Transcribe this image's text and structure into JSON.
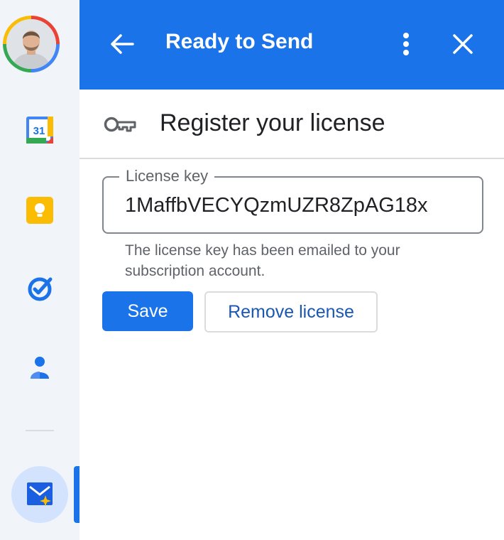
{
  "header": {
    "title": "Ready to Send",
    "back_icon": "arrow-left-icon",
    "menu_icon": "more-vert-icon",
    "close_icon": "close-icon",
    "color": "#1a73e8"
  },
  "section": {
    "title": "Register your license",
    "icon": "key-icon"
  },
  "license_field": {
    "label": "License key",
    "value": "1MaffbVECYQzmUZR8ZpAG18x"
  },
  "helper_text": "The license key has been emailed to your subscription account.",
  "actions": {
    "save_label": "Save",
    "remove_label": "Remove license"
  },
  "side_rail": {
    "items": [
      {
        "name": "Google Calendar",
        "icon": "calendar-icon",
        "label": "31"
      },
      {
        "name": "Google Keep",
        "icon": "keep-icon"
      },
      {
        "name": "Google Tasks",
        "icon": "tasks-icon"
      },
      {
        "name": "Contacts",
        "icon": "contacts-icon"
      },
      {
        "name": "Ready to Send add-on",
        "icon": "mail-sparkle-icon",
        "active": true
      }
    ]
  }
}
